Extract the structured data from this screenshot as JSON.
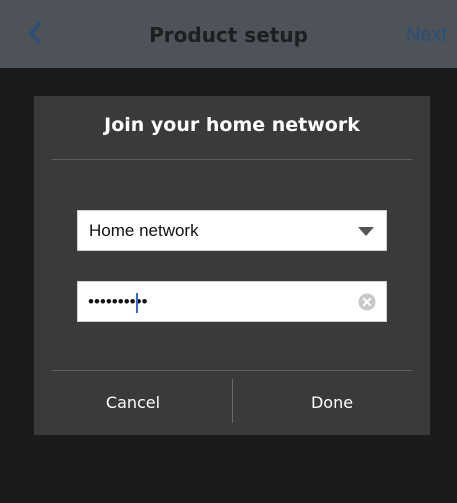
{
  "header": {
    "title": "Product setup",
    "next_label": "Next",
    "back_icon": "chevron-left-icon"
  },
  "dialog": {
    "title": "Join your home network",
    "network": {
      "selected": "Home network",
      "icon": "caret-down-icon"
    },
    "password": {
      "value": "••••••••••",
      "clear_icon": "clear-circle-icon"
    },
    "cancel_label": "Cancel",
    "done_label": "Done"
  },
  "colors": {
    "header_bg": "#4d5358",
    "page_bg": "#1b1b1b",
    "dialog_bg": "#3a3a3a",
    "accent": "#2a4e75",
    "cursor": "#3a67d6"
  }
}
